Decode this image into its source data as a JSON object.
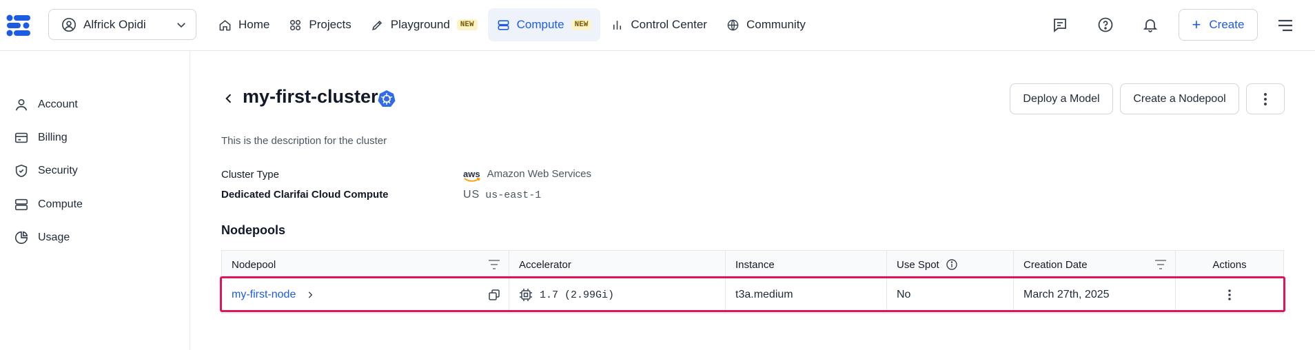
{
  "header": {
    "org_name": "Alfrick Opidi",
    "nav": [
      {
        "label": "Home",
        "icon": "home-icon"
      },
      {
        "label": "Projects",
        "icon": "grid-icon"
      },
      {
        "label": "Playground",
        "icon": "pen-icon",
        "badge": "NEW"
      },
      {
        "label": "Compute",
        "icon": "server-icon",
        "badge": "NEW",
        "active": true
      },
      {
        "label": "Control Center",
        "icon": "bar-chart-icon"
      },
      {
        "label": "Community",
        "icon": "globe-icon"
      }
    ],
    "create_label": "Create",
    "accent_color": "#1d5be0"
  },
  "sidebar": {
    "items": [
      {
        "label": "Account",
        "icon": "user-icon"
      },
      {
        "label": "Billing",
        "icon": "credit-card-icon"
      },
      {
        "label": "Security",
        "icon": "shield-icon"
      },
      {
        "label": "Compute",
        "icon": "server-icon"
      },
      {
        "label": "Usage",
        "icon": "pie-chart-icon"
      }
    ]
  },
  "cluster": {
    "name": "my-first-cluster",
    "description": "This is the description for the cluster",
    "actions": {
      "deploy": "Deploy a Model",
      "create_nodepool": "Create a Nodepool"
    },
    "fields": {
      "type_label": "Cluster Type",
      "type_logo": "aws",
      "type_value": "Amazon Web Services",
      "compute_label": "Dedicated Clarifai Cloud Compute",
      "region_code": "US",
      "region_value": "us-east-1"
    }
  },
  "nodepools": {
    "heading": "Nodepools",
    "columns": [
      "Nodepool",
      "Accelerator",
      "Instance",
      "Use Spot",
      "Creation Date",
      "Actions"
    ],
    "rows": [
      {
        "nodepool": "my-first-node",
        "accelerator": "1.7 (2.99Gi)",
        "instance": "t3a.medium",
        "use_spot": "No",
        "created": "March 27th, 2025"
      }
    ],
    "highlight_color": "#e0145a"
  }
}
